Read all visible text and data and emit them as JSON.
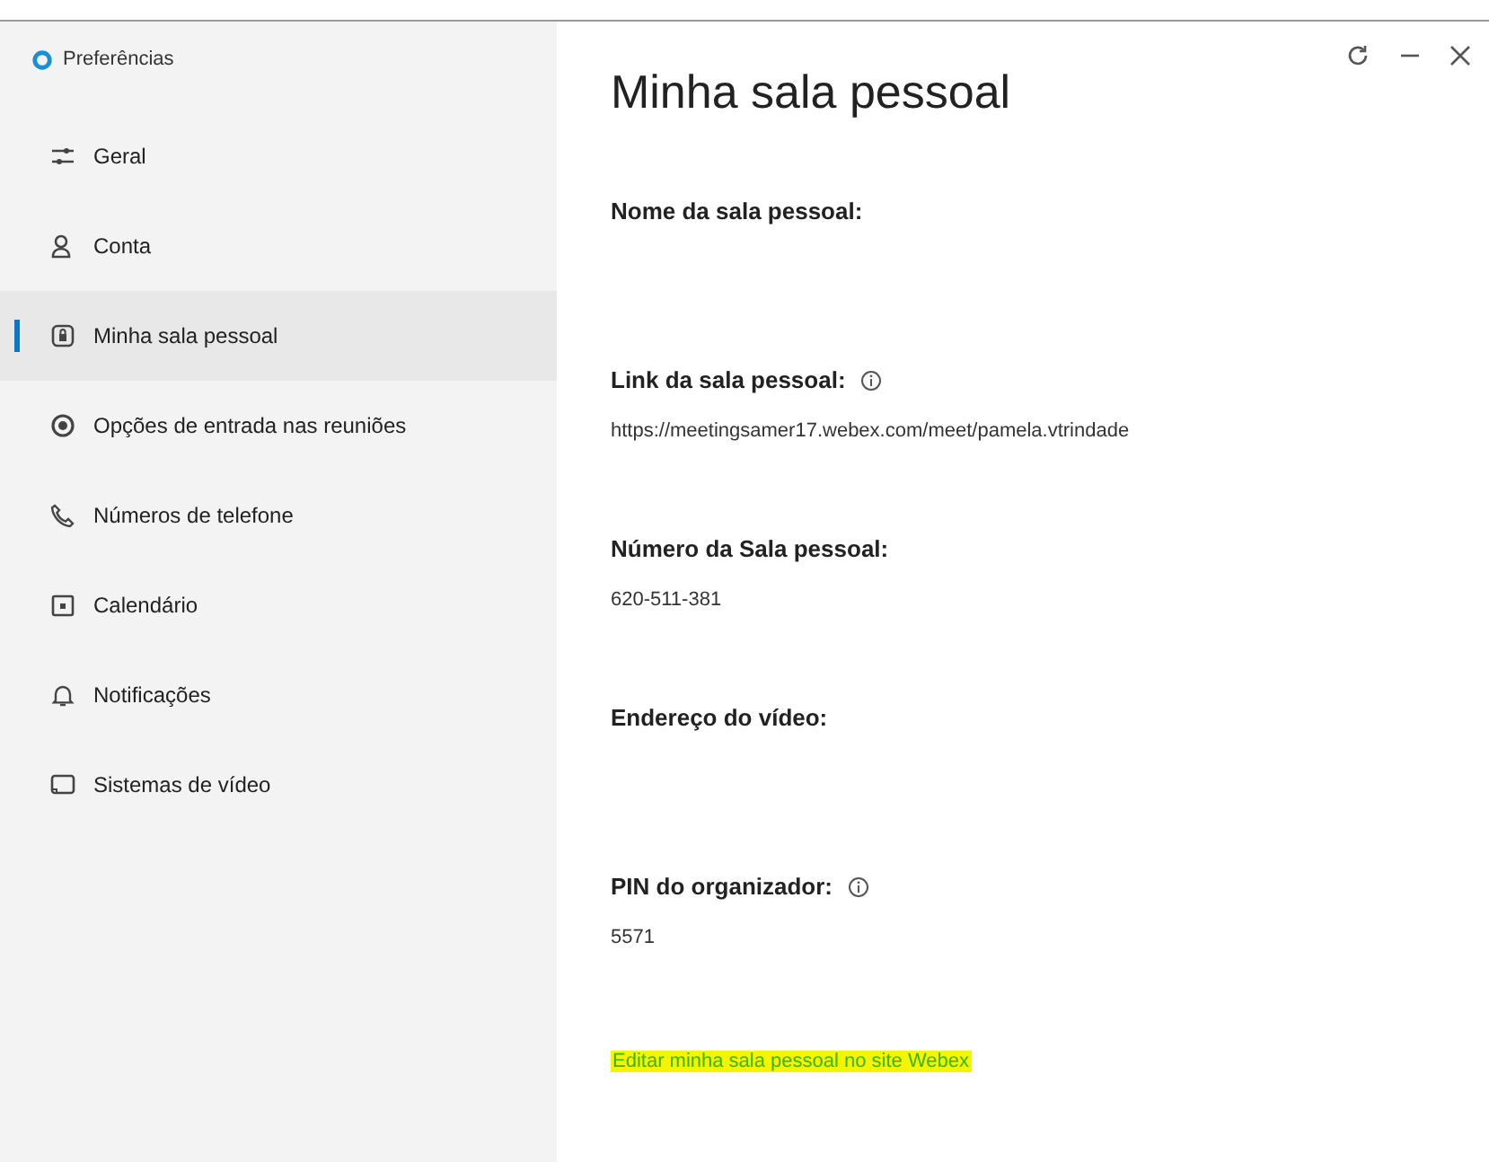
{
  "window": {
    "title": "Preferências"
  },
  "sidebar": {
    "items": [
      {
        "label": "Geral",
        "selected": false
      },
      {
        "label": "Conta",
        "selected": false
      },
      {
        "label": "Minha sala pessoal",
        "selected": true
      },
      {
        "label": "Opções de entrada nas reuniões",
        "selected": false
      },
      {
        "label": "Números de telefone",
        "selected": false
      },
      {
        "label": "Calendário",
        "selected": false
      },
      {
        "label": "Notificações",
        "selected": false
      },
      {
        "label": "Sistemas de vídeo",
        "selected": false
      }
    ]
  },
  "main": {
    "heading": "Minha sala pessoal",
    "fields": [
      {
        "label": "Nome da sala pessoal:",
        "info": false
      },
      {
        "label": "Link da sala pessoal:",
        "info": true,
        "value": "https://meetingsamer17.webex.com/meet/pamela.vtrindade"
      },
      {
        "label": "Número da Sala pessoal:",
        "info": false,
        "value": "620-511-381"
      },
      {
        "label": "Endereço do vídeo:",
        "info": false
      },
      {
        "label": "PIN do organizador:",
        "info": true,
        "value": "5571"
      }
    ],
    "edit_link": {
      "text": "Editar minha sala pessoal no site Webex",
      "highlighted": true
    }
  }
}
